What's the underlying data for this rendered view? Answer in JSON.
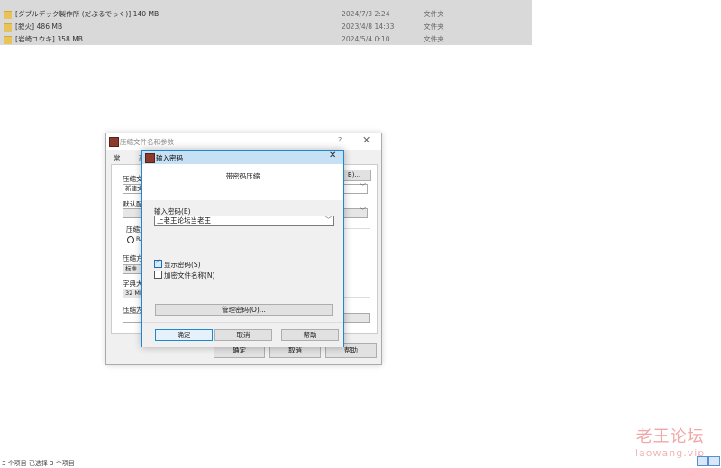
{
  "file_list": {
    "rows": [
      {
        "name": "[ダブルデック製作所 (だぶるでっく)]   140 MB",
        "date": "2024/7/3 2:24",
        "type": "文件夹"
      },
      {
        "name": "[叙火]  486 MB",
        "date": "2023/4/8 14:33",
        "type": "文件夹"
      },
      {
        "name": "[岩崎ユウキ]   358 MB",
        "date": "2024/5/4 0:10",
        "type": "文件夹"
      }
    ]
  },
  "rar_window": {
    "title": "压缩文件名和参数",
    "help": "?",
    "close": "✕",
    "tabs": [
      "常规",
      "高"
    ],
    "labels": {
      "archive_name": "压缩文",
      "default_profile": "默认配",
      "archive_format": "压缩文",
      "rar_option": "RA",
      "compression_method": "压缩方",
      "dictionary_size": "字典大",
      "volume_size": "压缩为"
    },
    "fields": {
      "archive_name_value": "新建文",
      "method_value": "标准",
      "dict_value": "32 MB"
    },
    "browse_button": "B)...",
    "ok": "确定",
    "cancel": "取消",
    "help_btn": "帮助"
  },
  "password_dialog": {
    "title": "输入密码",
    "close": "✕",
    "header": "带密码压缩",
    "password_label": "输入密码(E)",
    "password_value": "上老王论坛当老王",
    "show_password_label": "显示密码(S)",
    "show_password_checked": true,
    "encrypt_names_label": "加密文件名称(N)",
    "encrypt_names_checked": false,
    "organize_button": "管理密码(O)...",
    "ok": "确定",
    "cancel": "取消",
    "help": "帮助"
  },
  "watermark": {
    "title": "老王论坛",
    "url": "laowang.vip"
  },
  "status_bar": {
    "text": "3 个项目    已选择 3 个项目"
  },
  "colors": {
    "accent": "#1c88d3",
    "folder": "#e8c25a"
  }
}
